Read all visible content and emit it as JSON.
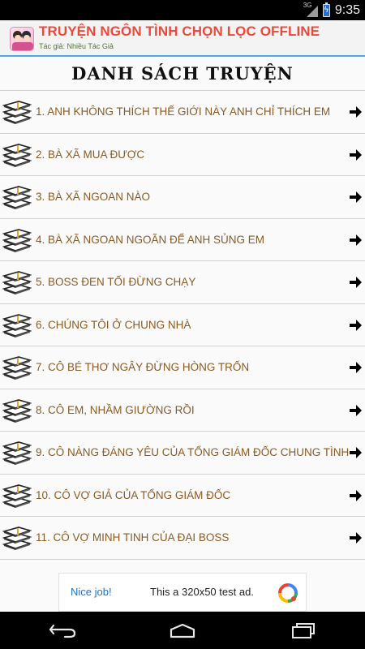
{
  "status_bar": {
    "network": "3G",
    "time": "9:35"
  },
  "app": {
    "title": "TRUYỆN NGÔN TÌNH CHỌN LỌC OFFLINE",
    "subtitle": "Tác giả: Nhiều Tác Giả"
  },
  "list_heading": "Danh sách truyện",
  "stories": [
    "1. ANH KHÔNG THÍCH THẾ GIỚI NÀY ANH CHỈ THÍCH EM",
    "2. BÀ XÃ MUA ĐƯỢC",
    "3. BÀ XÃ NGOAN NÀO",
    "4. BÀ XÃ NGOAN NGOÃN ĐỂ ANH SỦNG EM",
    "5. BOSS ĐEN TỐI ĐỪNG CHẠY",
    "6. CHÚNG TÔI Ở CHUNG NHÀ",
    "7. CÔ BÉ THƠ NGÂY ĐỪNG HÒNG TRỐN",
    "8. CÔ EM, NHẦM GIƯỜNG RỒI",
    "9. CÔ NÀNG ĐÁNG YÊU CỦA TỔNG GIÁM ĐỐC CHUNG TÌNH",
    "10. CÔ VỢ GIẢ CỦA TỔNG GIÁM ĐỐC",
    "11. CÔ VỢ MINH TINH CỦA ĐẠI BOSS"
  ],
  "ad": {
    "nice_label": "Nice job!",
    "text": "This a 320x50 test ad."
  },
  "icons": {
    "row_icon": "book-stack-icon",
    "row_arrow": "arrow-right-icon",
    "nav": [
      "back-icon",
      "home-icon",
      "recent-apps-icon"
    ]
  },
  "colors": {
    "title": "#ea4a3a",
    "subtitle": "#4a7d22",
    "story_text": "#8a5a22",
    "accent_line": "#4aa9e6",
    "ad_link": "#1a73c8"
  }
}
